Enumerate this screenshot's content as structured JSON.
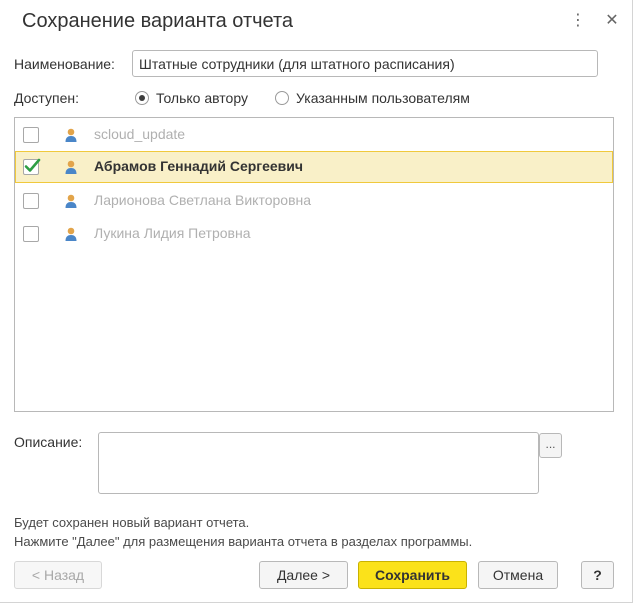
{
  "window": {
    "title": "Сохранение варианта отчета",
    "more_glyph": "⋮",
    "close_glyph": "✕"
  },
  "form": {
    "name_label": "Наименование:",
    "name_value": "Штатные сотрудники (для штатного расписания)",
    "available_label": "Доступен:",
    "radio_author": "Только автору",
    "radio_users": "Указанным пользователям",
    "selected_radio": "author",
    "description_label": "Описание:",
    "description_value": "",
    "dots_label": "..."
  },
  "users": [
    {
      "name": "scloud_update",
      "checked": false,
      "selected": false
    },
    {
      "name": "Абрамов Геннадий Сергеевич",
      "checked": true,
      "selected": true
    },
    {
      "name": "Ларионова Светлана Викторовна",
      "checked": false,
      "selected": false
    },
    {
      "name": "Лукина Лидия Петровна",
      "checked": false,
      "selected": false
    }
  ],
  "info": {
    "line1": "Будет сохранен новый вариант отчета.",
    "line2": "Нажмите \"Далее\" для размещения варианта отчета в разделах программы."
  },
  "buttons": {
    "back": "< Назад",
    "next": "Далее >",
    "save": "Сохранить",
    "cancel": "Отмена",
    "help": "?"
  },
  "colors": {
    "primary_button": "#fbe21a",
    "selected_row_bg": "#f9f0c8",
    "selected_row_border": "#f0c93c",
    "check_mark": "#2e9e44",
    "user_icon_head": "#e2a44a",
    "user_icon_body": "#4a86c8"
  }
}
